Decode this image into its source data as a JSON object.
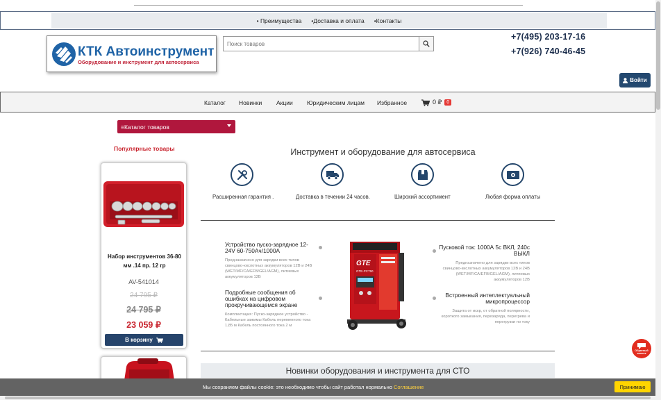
{
  "topnav": {
    "items": [
      "• Преимущества",
      "•Доставка и оплата",
      "•Контакты"
    ]
  },
  "logo": {
    "title": "КТК Автоинструмент",
    "subtitle": "Оборудование и инструмент для автосервиса"
  },
  "search": {
    "placeholder": "Поиск товаров",
    "icon": "search-icon"
  },
  "contacts": {
    "phone1": "+7(495) 203-17-16",
    "phone2": "+7(926) 740-46-45"
  },
  "login": {
    "label": "Войти",
    "icon": "user-icon"
  },
  "mainnav": {
    "items": [
      "Каталог",
      "Новинки",
      "Акции",
      "Юридическим лицам",
      "Избранное"
    ],
    "cart_total": "0 ₽",
    "cart_count": "0"
  },
  "catalog_button": {
    "label": "≡Каталог товаров"
  },
  "sidebar": {
    "popular_title": "Популярные товары",
    "product": {
      "name": "Набор инструментов 36-80 мм .14 пр. 12 гр",
      "sku": "AV-541014",
      "old_price_1": "24 795 ₽",
      "old_price_2": "24 795 ₽",
      "price": "23 059 ₽",
      "buy_label": "В корзину"
    }
  },
  "main": {
    "heading": "Инструмент и оборудование для автосервиса",
    "features": [
      {
        "label": "Расширенная гарантия .",
        "icon": "tools-icon"
      },
      {
        "label": "Доставка в течении 24 часов.",
        "icon": "truck-icon"
      },
      {
        "label": "Широкий ассортимент",
        "icon": "box-icon"
      },
      {
        "label": "Любая форма оплаты",
        "icon": "money-icon"
      }
    ],
    "specs_left": [
      {
        "title": "Устройство пуско-зарядное 12-24V 60-750Ач/1000А",
        "desc": "Предназначено для зарядки всех типов свинцово-кислотных аккумуляторов 12В и 24В (WET/MF/CA/EFB/GEL/AGM), литиевых аккумуляторов 12В"
      },
      {
        "title": "Подробные сообщения об ошибках на цифровом прокручивающемся экране",
        "desc": "Комплектация: Пуско-зарядное устройство - Кабельные зажимы Кабель переменного тока 1,85 м Кабель постоянного тока 2 м"
      }
    ],
    "specs_right": [
      {
        "title": "Пусковой ток: 1000А 5с ВКЛ, 240с ВЫКЛ",
        "desc": "Предназначено для зарядки всех типов свинцово-кислотных аккумуляторов 12В и 24В (WET/MF/CA/EFB/GEL/AGM), литиевых аккумуляторов 12В"
      },
      {
        "title": "Встроенный интеллектуальный микропроцессор",
        "desc": "Защита от искр, от обратной полярности, короткого замыкания, перезаряда, перегрева и перегрузки по току"
      }
    ],
    "device_brand": "GTE",
    "device_model": "GTE-PC750",
    "new_section": "Новинки оборудования и инструмента для СТО"
  },
  "cookie": {
    "text": "Мы сохраняем файлы cookie: это необходимо чтобы сайт работал нормально",
    "link": "Соглашение",
    "accept": "Принимаю"
  },
  "callback": {
    "line1": "Обратный",
    "line2": "звонок"
  },
  "colors": {
    "brand_blue": "#1f63a6",
    "brand_red": "#c0263a",
    "navy": "#24466b",
    "catalog_red": "#b0173d",
    "cookie_yellow": "#ffd400"
  }
}
